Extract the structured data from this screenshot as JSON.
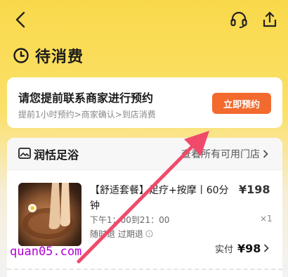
{
  "page": {
    "title": "待消费"
  },
  "booking": {
    "title": "请您提前联系商家进行预约",
    "subtitle": "提前1小时预约>商家确认>到店消费",
    "button_label": "立即预约"
  },
  "store": {
    "name": "润恬足浴",
    "link_label": "查看所有可用门店"
  },
  "product": {
    "title": "【舒适套餐】足疗+按摩丨60分钟",
    "time": "下午1：00到21：00",
    "policy": "随时退 过期退",
    "price": "¥198",
    "quantity": "×1",
    "paid_label": "实付",
    "paid_value": "¥98"
  },
  "watermark": "quan05.com",
  "colors": {
    "accent": "#f26a2e",
    "header_yellow": "#f9d94a",
    "annotation_arrow": "#f04a6a",
    "watermark": "#b300d6"
  },
  "icons": [
    "back-icon",
    "headset-icon",
    "share-icon",
    "clock-icon",
    "store-icon",
    "chevron-right-icon",
    "info-icon"
  ]
}
